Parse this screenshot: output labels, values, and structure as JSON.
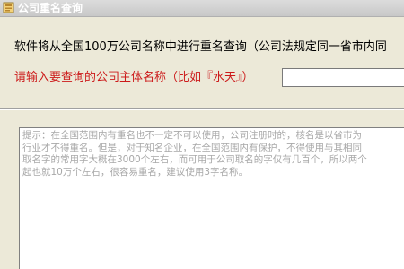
{
  "window": {
    "title": "公司重名查询"
  },
  "top": {
    "info_text": "软件将从全国100万公司名称中进行重名查询（公司法规定同一省市内同",
    "prompt_label": "请输入要查询的公司主体名称（比如『水天』）",
    "input_value": ""
  },
  "tip": {
    "text": "提示：在全国范围内有重名也不一定不可以使用，公司注册时的，核名是以省市为\n行业才不得重名。但是，对于知名企业，在全国范围内有保护，不得使用与其相同\n取名字的常用字大概在3000个左右，而可用于公司取名的字仅有几百个，所以两个\n起也就10万个左右，很容易重名，建议使用3字名称。"
  }
}
